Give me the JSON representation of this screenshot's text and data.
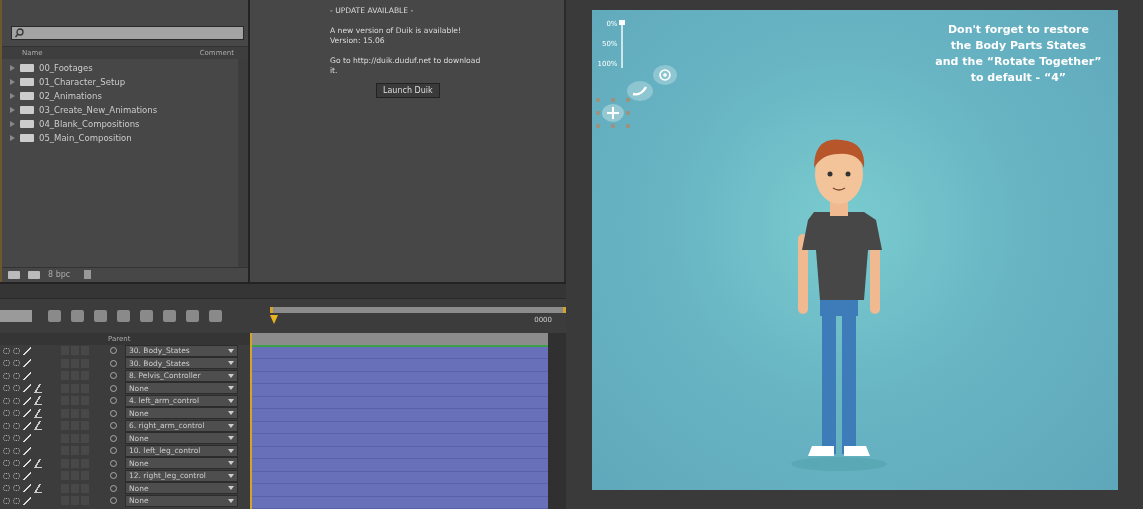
{
  "project": {
    "columns": [
      "Name",
      "Comment"
    ],
    "folders": [
      {
        "name": "00_Footages",
        "expanded": false
      },
      {
        "name": "01_Character_Setup",
        "expanded": false
      },
      {
        "name": "02_Animations",
        "expanded": false
      },
      {
        "name": "03_Create_New_Animations",
        "expanded": false
      },
      {
        "name": "04_Blank_Compositions",
        "expanded": false
      },
      {
        "name": "05_Main_Composition",
        "expanded": false
      }
    ],
    "bit_depth": "8 bpc"
  },
  "duik_panel": {
    "heading": "- UPDATE AVAILABLE -",
    "message": "A new version of Duik is available!",
    "version": "Version: 15.06",
    "download": "Go to http://duik.duduf.net to download it.",
    "button": "Launch Duik"
  },
  "timeline": {
    "end_time": "0000",
    "parent_header": "Parent",
    "layers": [
      {
        "parent": "30. Body_States",
        "fx": false
      },
      {
        "parent": "30. Body_States",
        "fx": false
      },
      {
        "parent": "8. Pelvis_Controller",
        "fx": false
      },
      {
        "parent": "None",
        "fx": true
      },
      {
        "parent": "4. left_arm_control",
        "fx": true
      },
      {
        "parent": "None",
        "fx": true
      },
      {
        "parent": "6. right_arm_control",
        "fx": true
      },
      {
        "parent": "None",
        "fx": false
      },
      {
        "parent": "10. left_leg_control",
        "fx": false
      },
      {
        "parent": "None",
        "fx": true
      },
      {
        "parent": "12. right_leg_control",
        "fx": false
      },
      {
        "parent": "None",
        "fx": true
      },
      {
        "parent": "None",
        "fx": false
      }
    ]
  },
  "viewer": {
    "note": [
      "Don't forget to restore",
      "the Body Parts States",
      "and the “Rotate Together”",
      "to default - “4”"
    ],
    "slider_labels": [
      "0%",
      "50%",
      "100%"
    ],
    "slider": {
      "level": 0.1
    }
  }
}
